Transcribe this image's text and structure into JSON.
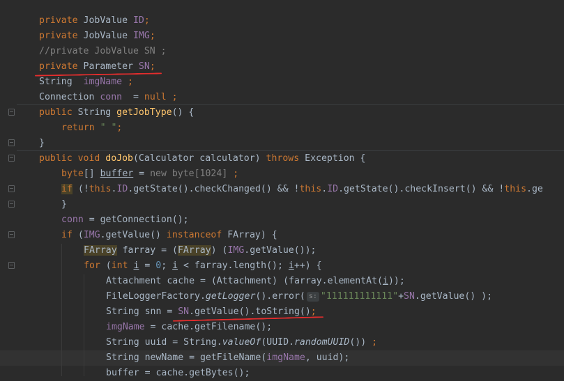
{
  "code": {
    "line1": {
      "kw": "private",
      "type": " JobValue ",
      "field": "ID",
      "semi": ";"
    },
    "line2": {
      "kw": "private",
      "type": " JobValue ",
      "field": "IMG",
      "semi": ";"
    },
    "line3": {
      "comment": "//private JobValue SN ;"
    },
    "line4": {
      "kw": "private",
      "type": " Parameter ",
      "field": "SN",
      "semi": ";"
    },
    "line5": {
      "type": "String  ",
      "field": "imgName",
      "semi": " ;"
    },
    "line6": {
      "type": "Connection ",
      "field": "conn",
      "eq": "  = ",
      "kwnull": "null",
      "semi": " ;"
    },
    "line7": {
      "kw": "public",
      "type": " String ",
      "method": "getJobType",
      "rest": "() {"
    },
    "line8": {
      "kw": "return",
      "str": " \" \"",
      "semi": ";"
    },
    "line9": {
      "rest": "}"
    },
    "line10": {
      "kw1": "public",
      "kw2": " void ",
      "method": "doJob",
      "rest1": "(Calculator calculator) ",
      "kw3": "throws",
      "rest2": " Exception {"
    },
    "line11": {
      "kwtype": "byte",
      "rest1": "[] ",
      "var": "buffer",
      "rest2": " = ",
      "kwnew": "new byte",
      "rest3": "[",
      "num": "1024",
      "rest4": "] ",
      "semi": ";"
    },
    "line12": {
      "kwif": "if",
      "rest1": " (!",
      "this1": "this",
      "d1": ".",
      "id1": "ID",
      ".rest2": "",
      "rest2": ".getState().checkChanged() && !",
      "this2": "this",
      "d2": ".",
      "id2": "ID",
      "rest3": ".getState().checkInsert() && !",
      "this3": "this",
      "d3": ".",
      "rest4": "ge"
    },
    "line13": {
      "rest": "}"
    },
    "line14": {
      "field": "conn",
      "rest": " = getConnection();"
    },
    "line15": {
      "kwif": "if",
      "rest1": " (",
      "field": "IMG",
      "rest2": ".getValue() ",
      "kwinst": "instanceof",
      "rest3": " FArray) {"
    },
    "line16": {
      "t1": "FArray",
      "rest1": " farray = (",
      "t2": "FArray",
      "rest2": ") (",
      "field": "IMG",
      "rest3": ".getValue());"
    },
    "line17": {
      "kwfor": "for",
      "rest1": " (",
      "kwint": "int",
      "rest2": " ",
      "var1": "i",
      "rest3": " = ",
      "num": "0",
      "rest4": "; ",
      "var2": "i",
      "rest5": " < farray.length(); ",
      "var3": "i",
      "rest6": "++) {"
    },
    "line18": {
      "rest1": "Attachment cache = (Attachment) (farray.elementAt(",
      "var": "i",
      "rest2": "));"
    },
    "line19": {
      "rest1": "FileLoggerFactory.",
      "m1": "getLogger",
      "rest2": "().error(",
      "hint": "s:",
      "str": "\"111111111111\"",
      "rest3": "+",
      "field": "SN",
      "rest4": ".getValue() );"
    },
    "line20": {
      "rest1": "String snn = ",
      "field": "SN",
      "rest2": ".getValue().toString()",
      "semi": ";"
    },
    "line21": {
      "field": "imgName",
      "rest": " = cache.getFilename();"
    },
    "line22": {
      "rest1": "String uuid = String.",
      "m1": "valueOf",
      "rest2": "(UUID.",
      "m2": "randomUUID",
      "rest3": "()) ",
      "semi": ";"
    },
    "line23": {
      "rest1": "String newName = getFileName(",
      "field": "imgName",
      "rest2": ", uuid);"
    },
    "line24": {
      "rest1": "buffer = cache.getBytes();"
    }
  },
  "colors": {
    "background": "#2b2b2b",
    "keyword": "#cc7832",
    "field": "#9876aa",
    "method": "#ffc66d",
    "string": "#6a8759",
    "number": "#6897bb",
    "comment": "#808080",
    "annotation_underline": "#e52d2d"
  }
}
